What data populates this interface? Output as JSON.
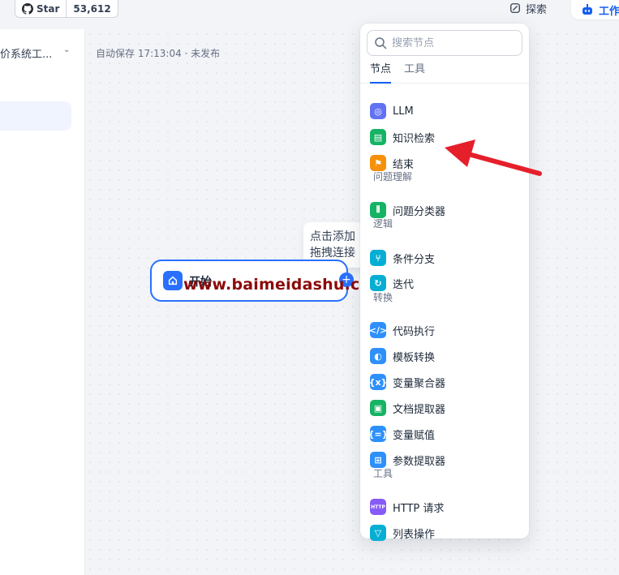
{
  "topbar": {
    "github_star_label": "Star",
    "github_star_count": "53,612",
    "explore_label": "探索",
    "workflow_tab_label": "工作"
  },
  "sidebar": {
    "app_name": "价系统工...",
    "chevron": "⌄"
  },
  "canvas": {
    "autosave_status": "自动保存 17:13:04 · 未发布",
    "start_node_label": "开始",
    "tooltip_line1": "点击添加",
    "tooltip_line2": "拖拽连接",
    "add_handle": "+",
    "watermark": "www.baimeidashu.com-白眉大叔"
  },
  "picker": {
    "search_placeholder": "搜索节点",
    "tabs": [
      "节点",
      "工具"
    ],
    "items": [
      {
        "label": "LLM",
        "icon": "llm-icon",
        "color": "#6172f3",
        "glyph": "◎"
      },
      {
        "label": "知识检索",
        "icon": "knowledge-retrieval-icon",
        "color": "#16b364",
        "glyph": "▤"
      },
      {
        "label": "结束",
        "icon": "end-icon",
        "color": "#f79009",
        "glyph": "⚑"
      },
      {
        "group": "问题理解"
      },
      {
        "label": "问题分类器",
        "icon": "question-classifier-icon",
        "color": "#16b364",
        "glyph": "⫴"
      },
      {
        "group": "逻辑"
      },
      {
        "label": "条件分支",
        "icon": "if-else-icon",
        "color": "#06aed4",
        "glyph": "⑂"
      },
      {
        "label": "迭代",
        "icon": "iteration-icon",
        "color": "#06aed4",
        "glyph": "↻"
      },
      {
        "group": "转换"
      },
      {
        "label": "代码执行",
        "icon": "code-icon",
        "color": "#2e90fa",
        "glyph": "</>"
      },
      {
        "label": "模板转换",
        "icon": "template-transform-icon",
        "color": "#2e90fa",
        "glyph": "◐"
      },
      {
        "label": "变量聚合器",
        "icon": "variable-aggregator-icon",
        "color": "#2e90fa",
        "glyph": "{x}"
      },
      {
        "label": "文档提取器",
        "icon": "document-extractor-icon",
        "color": "#16b364",
        "glyph": "▣"
      },
      {
        "label": "变量赋值",
        "icon": "variable-assigner-icon",
        "color": "#2e90fa",
        "glyph": "{=}"
      },
      {
        "label": "参数提取器",
        "icon": "parameter-extractor-icon",
        "color": "#2e90fa",
        "glyph": "⊞"
      },
      {
        "group": "工具"
      },
      {
        "label": "HTTP 请求",
        "icon": "http-request-icon",
        "color": "#875bf7",
        "glyph": "HTTP"
      },
      {
        "label": "列表操作",
        "icon": "list-operator-icon",
        "color": "#06aed4",
        "glyph": "▽"
      }
    ]
  },
  "colors": {
    "accent": "#155eef",
    "arrow": "#e5202a"
  }
}
